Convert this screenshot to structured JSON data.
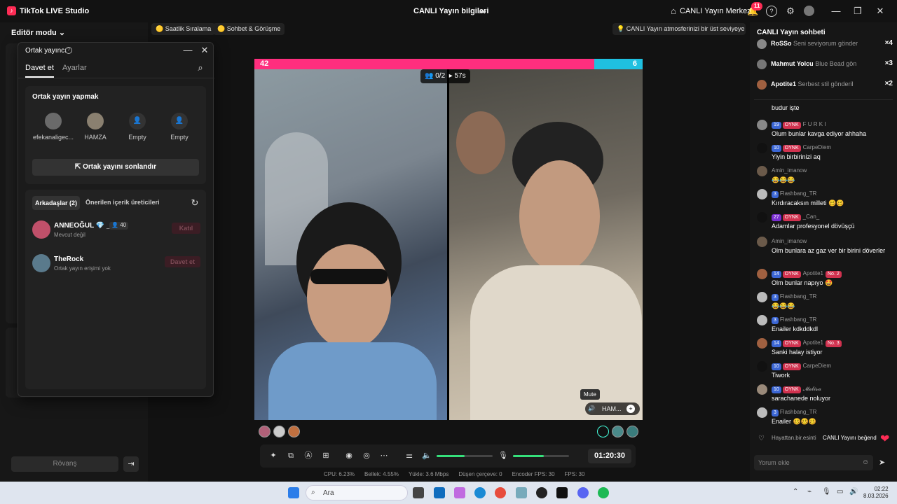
{
  "titlebar": {
    "app_name": "TikTok LIVE Studio",
    "window_title": "CANLI Yayın bilgileri",
    "center_button": "CANLI Yayın Merkezi",
    "notif_count": "11"
  },
  "left": {
    "editor_mode": "Editör modu",
    "rematch": "Rövanş"
  },
  "modal": {
    "title": "Ortak yayıncı",
    "tabs": [
      "Davet et",
      "Ayarlar"
    ],
    "section_title": "Ortak yayın yapmak",
    "slots": [
      "efekanaligec...",
      "HAMZA",
      "Empty",
      "Empty"
    ],
    "end_button": "Ortak yayını sonlandır",
    "friends_tab": "Arkadaşlar (2)",
    "creators_tab": "Önerilen içerik üreticileri",
    "friends": [
      {
        "name": "ANNEOĞUL 💎 _61",
        "count": "40",
        "status": "Mevcut değil",
        "action": "Katıl"
      },
      {
        "name": "TheRock",
        "count": "",
        "status": "Ortak yayın erişimi yok",
        "action": "Davet et"
      }
    ]
  },
  "topstrip": {
    "pill1": "Saatlik Sıralama",
    "pill2": "Sohbet & Görüşme",
    "tip": "CANLI Yayın atmosferinizi bir üst seviyeye ..."
  },
  "video": {
    "score_left": "42",
    "score_right": "6",
    "counter": "0/2",
    "timer_small": "57s",
    "mute_tip": "Mute",
    "host_tag": "HAM..."
  },
  "controls": {
    "time": "01:20:30",
    "volume": 0.5,
    "mic": 0.55
  },
  "stats": [
    "CPU: 6.23%",
    "Bellek: 4.55%",
    "Yükle: 3.6 Mbps",
    "Düşen çerçeve: 0",
    "Encoder FPS: 30",
    "FPS: 30"
  ],
  "chat": {
    "title": "CANLI Yayın sohbeti",
    "gifts": [
      {
        "name": "RoSSo",
        "text": "Seni seviyorum gönder",
        "count": "×4"
      },
      {
        "name": "Mahmut Yolcu",
        "text": "Blue Bead gön",
        "count": "×3"
      },
      {
        "name": "Apotite1",
        "text": "Serbest stil gönderil",
        "count": "×2"
      }
    ],
    "messages": [
      {
        "lvl": "",
        "team": "",
        "user": "",
        "rank": "",
        "text": "budur işte"
      },
      {
        "lvl": "19",
        "team": "OYNK",
        "user": "F U R K I",
        "rank": "",
        "text": "Olum bunlar kavga ediyor ahhaha"
      },
      {
        "lvl": "10",
        "team": "OYNK",
        "user": "CarpeDiem",
        "rank": "",
        "text": "Yiyin birbirinizi aq"
      },
      {
        "lvl": "",
        "team": "",
        "user": "Amin_imanow",
        "rank": "",
        "text": "😂😂😂"
      },
      {
        "lvl": "3",
        "team": "",
        "user": "Flashbang_TR",
        "rank": "",
        "text": "Kırdıracaksın milleti 🥴🥴"
      },
      {
        "lvl": "27",
        "team": "OYNK",
        "user": "_Can_",
        "rank": "",
        "text": "Adamlar profesyonel dövüşçü"
      },
      {
        "lvl": "",
        "team": "",
        "user": "Amin_imanow",
        "rank": "",
        "text": "Olm bunlara az gaz ver bir birini döverler"
      },
      {
        "lvl": "14",
        "team": "OYNK",
        "user": "Apotite1",
        "rank": "No. 2",
        "text": "Olm bunlar napıyo 🤩"
      },
      {
        "lvl": "3",
        "team": "",
        "user": "Flashbang_TR",
        "rank": "",
        "text": "😂😂😂"
      },
      {
        "lvl": "3",
        "team": "",
        "user": "Flashbang_TR",
        "rank": "",
        "text": "Enailer kdkddkdl"
      },
      {
        "lvl": "14",
        "team": "OYNK",
        "user": "Apotite1",
        "rank": "No. 3",
        "text": "Sanki halay istiyor"
      },
      {
        "lvl": "10",
        "team": "OYNK",
        "user": "CarpeDiem",
        "rank": "",
        "text": "Tiwork"
      },
      {
        "lvl": "10",
        "team": "OYNK",
        "user": "𝓜𝓮𝓵𝓲𝓼𝓪",
        "rank": "",
        "text": "sarachanede noluyor"
      },
      {
        "lvl": "3",
        "team": "",
        "user": "Flashbang_TR",
        "rank": "",
        "text": "Enailer 🥴🥴🥴"
      }
    ],
    "like_user": "Hayattan.bir.esinti",
    "like_text": "CANLI Yayını beğend",
    "input_placeholder": "Yorum ekle"
  },
  "taskbar": {
    "search": "Ara",
    "time": "02:22",
    "date": "8.03.2026"
  }
}
